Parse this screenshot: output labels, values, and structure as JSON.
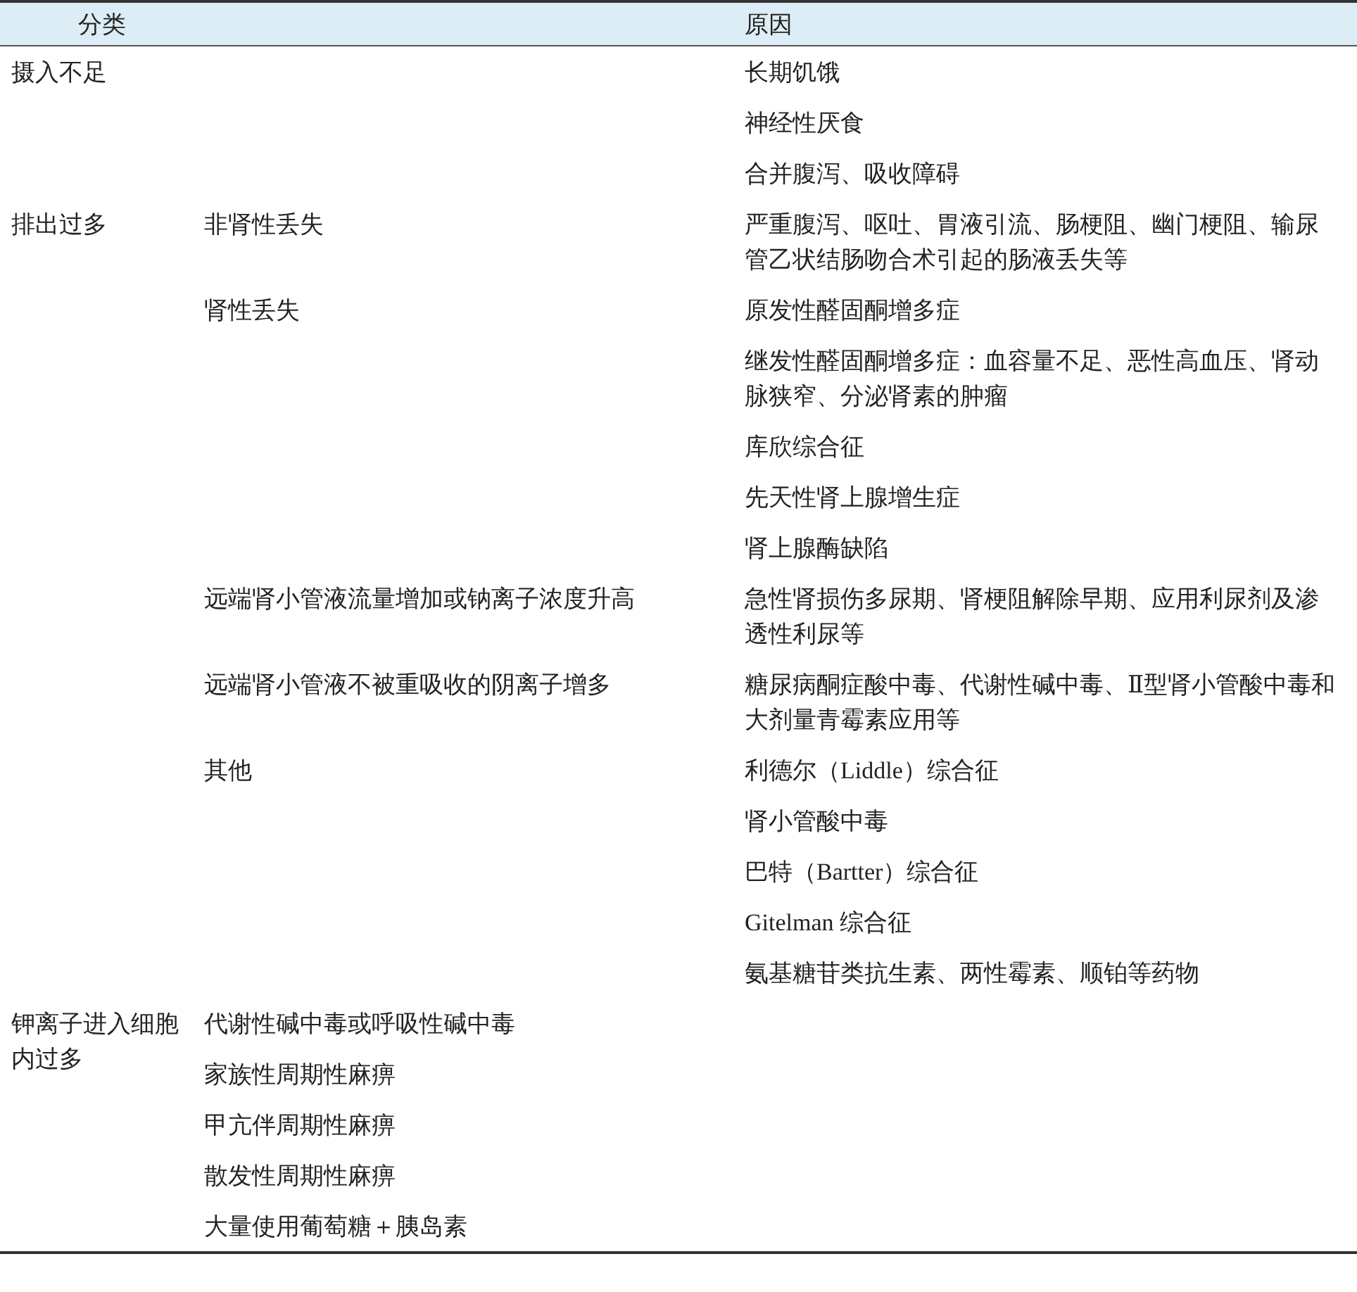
{
  "table": {
    "columns": [
      "分类",
      "原因"
    ],
    "categories": [
      {
        "name": "摄入不足",
        "subgroups": [
          {
            "causes": [
              "长期饥饿",
              "神经性厌食",
              "合并腹泻、吸收障碍"
            ]
          }
        ]
      },
      {
        "name": "排出过多",
        "subgroups": [
          {
            "name": "非肾性丢失",
            "causes": [
              "严重腹泻、呕吐、胃液引流、肠梗阻、幽门梗阻、输尿管乙状结肠吻合术引起的肠液丢失等"
            ]
          },
          {
            "name": "肾性丢失",
            "causes": [
              "原发性醛固酮增多症",
              "继发性醛固酮增多症：血容量不足、恶性高血压、肾动脉狭窄、分泌肾素的肿瘤",
              "库欣综合征",
              "先天性肾上腺增生症",
              "肾上腺酶缺陷"
            ]
          },
          {
            "name": "远端肾小管液流量增加或钠离子浓度升高",
            "causes": [
              "急性肾损伤多尿期、肾梗阻解除早期、应用利尿剂及渗透性利尿等"
            ]
          },
          {
            "name": "远端肾小管液不被重吸收的阴离子增多",
            "causes": [
              "糖尿病酮症酸中毒、代谢性碱中毒、Ⅱ型肾小管酸中毒和大剂量青霉素应用等"
            ]
          },
          {
            "name": "其他",
            "causes": [
              "利德尔（Liddle）综合征",
              "肾小管酸中毒",
              "巴特（Bartter）综合征",
              "Gitelman 综合征",
              "氨基糖苷类抗生素、两性霉素、顺铂等药物"
            ]
          }
        ]
      },
      {
        "name": "钾离子进入细胞内过多",
        "subgroups": [
          {
            "name": "代谢性碱中毒或呼吸性碱中毒"
          },
          {
            "name": "家族性周期性麻痹"
          },
          {
            "name": "甲亢伴周期性麻痹"
          },
          {
            "name": "散发性周期性麻痹"
          },
          {
            "name": "大量使用葡萄糖＋胰岛素"
          }
        ]
      }
    ]
  }
}
